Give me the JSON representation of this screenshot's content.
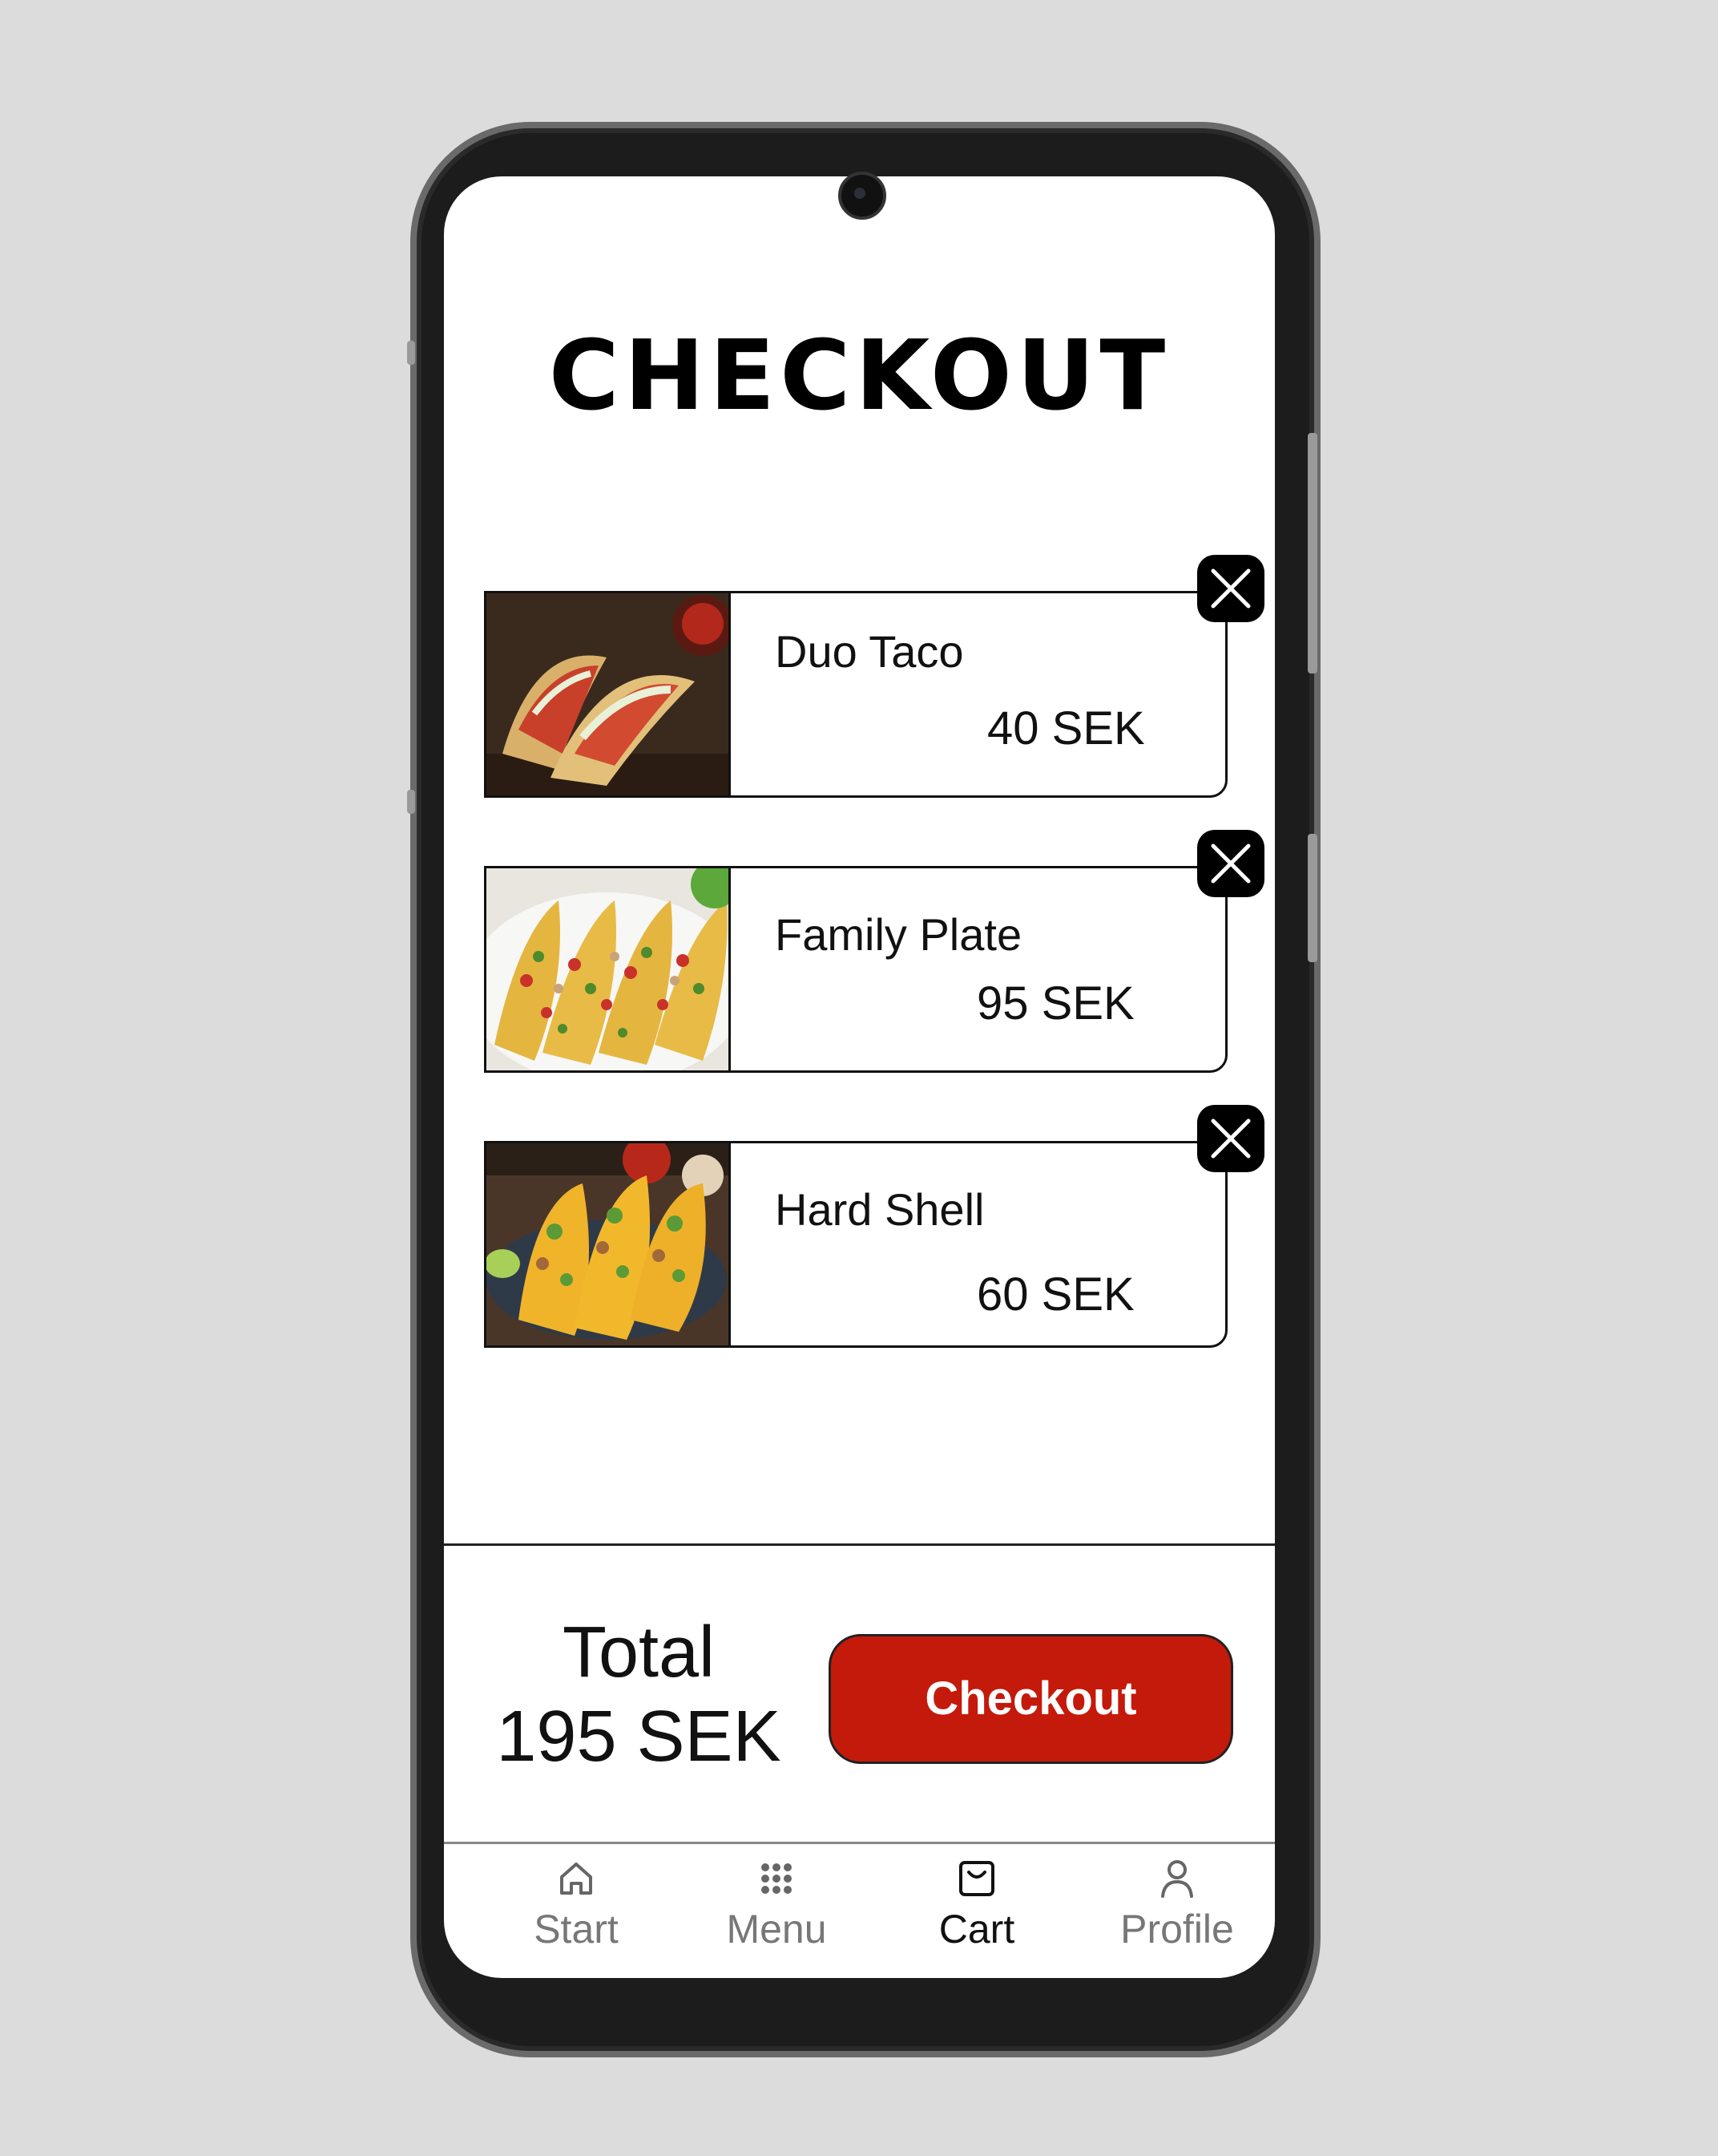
{
  "page": {
    "title": "CHECKOUT"
  },
  "cart": {
    "items": [
      {
        "name": "Duo Taco",
        "price": "40 SEK"
      },
      {
        "name": "Family Plate",
        "price": "95 SEK"
      },
      {
        "name": "Hard Shell",
        "price": "60 SEK"
      }
    ]
  },
  "summary": {
    "total_label": "Total",
    "total_value": "195 SEK",
    "checkout_label": "Checkout"
  },
  "nav": {
    "items": [
      {
        "label": "Start",
        "icon": "home-icon"
      },
      {
        "label": "Menu",
        "icon": "grid-icon"
      },
      {
        "label": "Cart",
        "icon": "bag-icon"
      },
      {
        "label": "Profile",
        "icon": "user-icon"
      }
    ],
    "active": "Cart"
  },
  "colors": {
    "accent": "#c41a0b",
    "text": "#111111",
    "inactive": "#777777"
  }
}
